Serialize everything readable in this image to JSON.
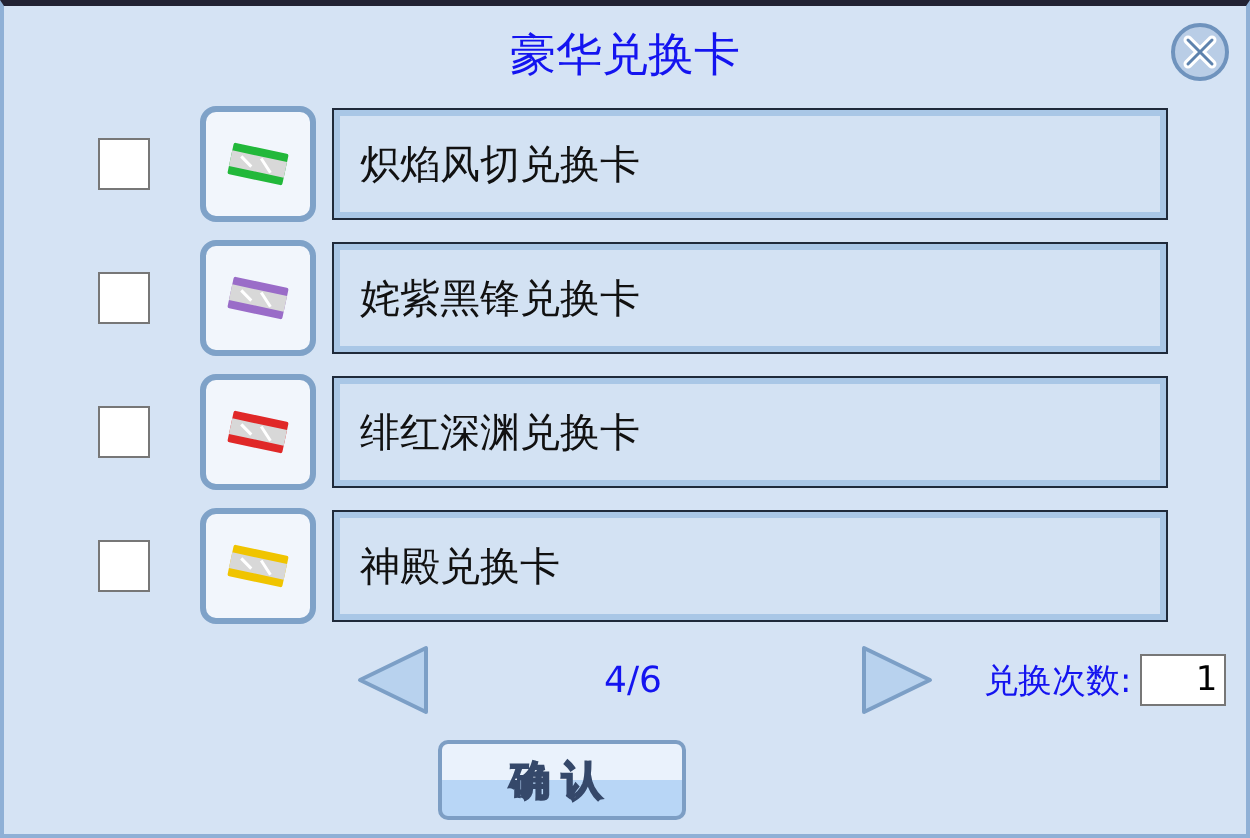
{
  "window": {
    "title": "豪华兑换卡"
  },
  "cards": [
    {
      "name": "炽焰风切兑换卡",
      "checked": false,
      "color": "#22b83a"
    },
    {
      "name": "姹紫黑锋兑换卡",
      "checked": false,
      "color": "#9a6cc8"
    },
    {
      "name": "绯红深渊兑换卡",
      "checked": false,
      "color": "#e02828"
    },
    {
      "name": "神殿兑换卡",
      "checked": false,
      "color": "#f0c400"
    }
  ],
  "pager": {
    "page": "4/6"
  },
  "count": {
    "label": "兑换次数:",
    "value": "1"
  },
  "confirm_button": "确认"
}
